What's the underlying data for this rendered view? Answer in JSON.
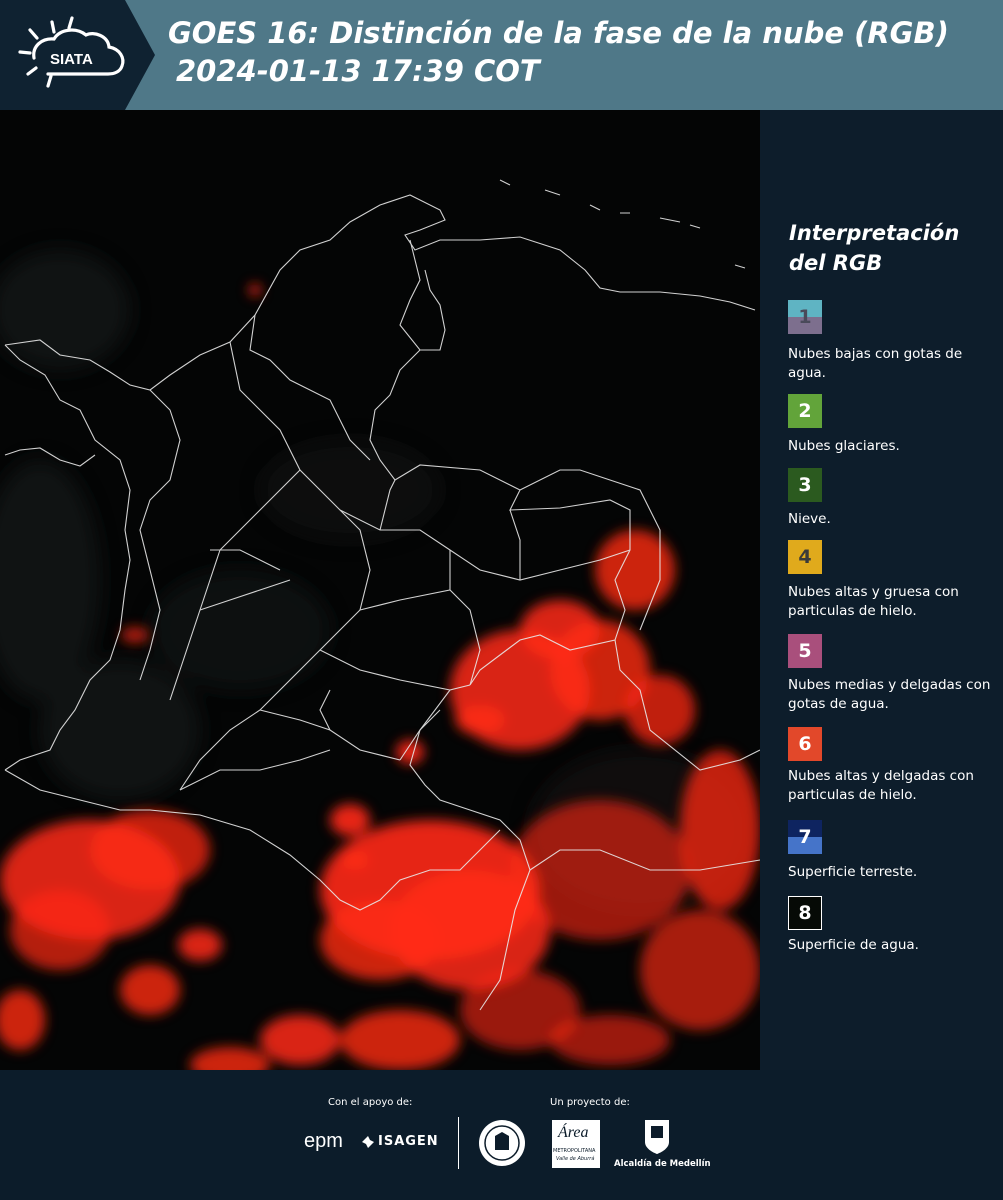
{
  "header": {
    "logo_text": "SIATA",
    "title": "GOES 16: Distinción de la fase de la nube (RGB)",
    "subtitle": "2024-01-13 17:39 COT"
  },
  "legend": {
    "title_line1": "Interpretación",
    "title_line2": "del RGB",
    "items": [
      {
        "num": "1",
        "label": "Nubes bajas con gotas de agua.",
        "color_top": "#5fb4c3",
        "color_bottom": "#7d6f8e",
        "text_color": "#4a4a5a"
      },
      {
        "num": "2",
        "label": "Nubes glaciares.",
        "color_top": "#62a43a",
        "color_bottom": "#62a43a",
        "text_color": "#ffffff"
      },
      {
        "num": "3",
        "label": "Nieve.",
        "color_top": "#2b5a1f",
        "color_bottom": "#2b5a1f",
        "text_color": "#ffffff"
      },
      {
        "num": "4",
        "label": "Nubes altas y gruesa con particulas de hielo.",
        "color_top": "#e0aa1c",
        "color_bottom": "#e0aa1c",
        "text_color": "#3a3a3a"
      },
      {
        "num": "5",
        "label": "Nubes medias y delgadas con gotas de agua.",
        "color_top": "#a94f7c",
        "color_bottom": "#a94f7c",
        "text_color": "#ffffff"
      },
      {
        "num": "6",
        "label": "Nubes altas y delgadas con particulas de hielo.",
        "color_top": "#e2482a",
        "color_bottom": "#e2482a",
        "text_color": "#ffffff"
      },
      {
        "num": "7",
        "label": "Superficie terreste.",
        "color_top": "#0e2460",
        "color_bottom": "#4574c9",
        "text_color": "#ffffff"
      },
      {
        "num": "8",
        "label": "Superficie de agua.",
        "color_top": "#060a06",
        "color_bottom": "#060a06",
        "text_color": "#ffffff"
      }
    ]
  },
  "footer": {
    "support_label": "Con el apoyo de:",
    "project_label": "Un proyecto de:",
    "sponsor_epm": "epm",
    "sponsor_isagen": "ISAGEN",
    "partner_area_line1": "Área",
    "partner_area_line2": "METROPOLITANA",
    "partner_area_line3": "Valle de Aburrá",
    "partner_alcaldia": "Alcaldía de Medellín"
  },
  "colors": {
    "header_bg": "#4f7888",
    "panel_bg": "#0d1d2b",
    "cloud_red": "#ff2a14"
  }
}
